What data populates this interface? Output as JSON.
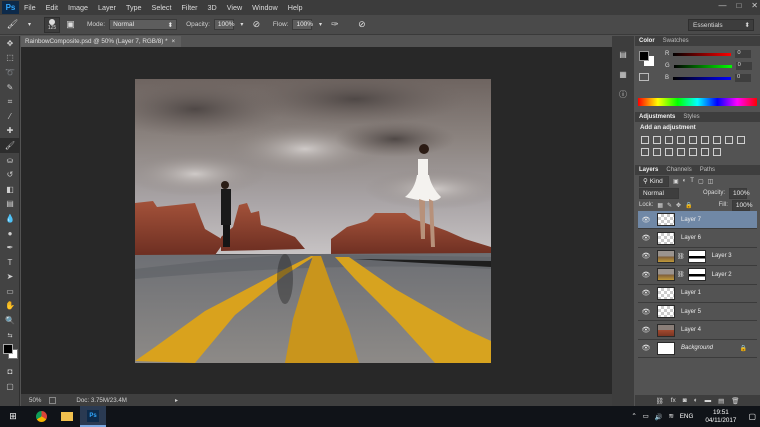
{
  "app": {
    "logo": "Ps"
  },
  "menu": [
    "File",
    "Edit",
    "Image",
    "Layer",
    "Type",
    "Select",
    "Filter",
    "3D",
    "View",
    "Window",
    "Help"
  ],
  "window_controls": {
    "minimize": "—",
    "maximize": "□",
    "close": "✕"
  },
  "options": {
    "brush_size": "125",
    "mode_label": "Mode:",
    "mode_value": "Normal",
    "opacity_label": "Opacity:",
    "opacity_value": "100%",
    "flow_label": "Flow:",
    "flow_value": "100%",
    "workspace": "Essentials"
  },
  "document": {
    "tab_title": "RainbowComposite.psd @ 50% (Layer 7, RGB/8) *",
    "tab_close": "×"
  },
  "status": {
    "zoom": "50%",
    "doc_size": "Doc: 3.75M/23.4M"
  },
  "color_panel": {
    "tabs": [
      "Color",
      "Swatches"
    ],
    "channels": [
      {
        "label": "R",
        "value": "0"
      },
      {
        "label": "G",
        "value": "0"
      },
      {
        "label": "B",
        "value": "0"
      }
    ],
    "foreground": "#000000",
    "background": "#ffffff"
  },
  "adjustments_panel": {
    "tabs": [
      "Adjustments",
      "Styles"
    ],
    "heading": "Add an adjustment"
  },
  "layers_panel": {
    "tabs": [
      "Layers",
      "Channels",
      "Paths"
    ],
    "filter_kind": "Kind",
    "blend_mode": "Normal",
    "opacity_label": "Opacity:",
    "opacity_value": "100%",
    "lock_label": "Lock:",
    "fill_label": "Fill:",
    "fill_value": "100%",
    "layers": [
      {
        "name": "Layer 7",
        "selected": true,
        "thumb": "checker"
      },
      {
        "name": "Layer 6",
        "selected": false,
        "thumb": "checker"
      },
      {
        "name": "Layer 3",
        "selected": false,
        "thumb": "scene",
        "mask": true
      },
      {
        "name": "Layer 2",
        "selected": false,
        "thumb": "scene",
        "mask": true
      },
      {
        "name": "Layer 1",
        "selected": false,
        "thumb": "checker"
      },
      {
        "name": "Layer 5",
        "selected": false,
        "thumb": "checker"
      },
      {
        "name": "Layer 4",
        "selected": false,
        "thumb": "desert"
      },
      {
        "name": "Background",
        "selected": false,
        "thumb": "white",
        "locked": true
      }
    ]
  },
  "taskbar": {
    "time": "19:51",
    "date": "04/11/2017",
    "lang": "ENG"
  },
  "colors": {
    "selected_layer": "#7088a6",
    "panel_bg": "#535353",
    "canvas_bg": "#282828"
  }
}
